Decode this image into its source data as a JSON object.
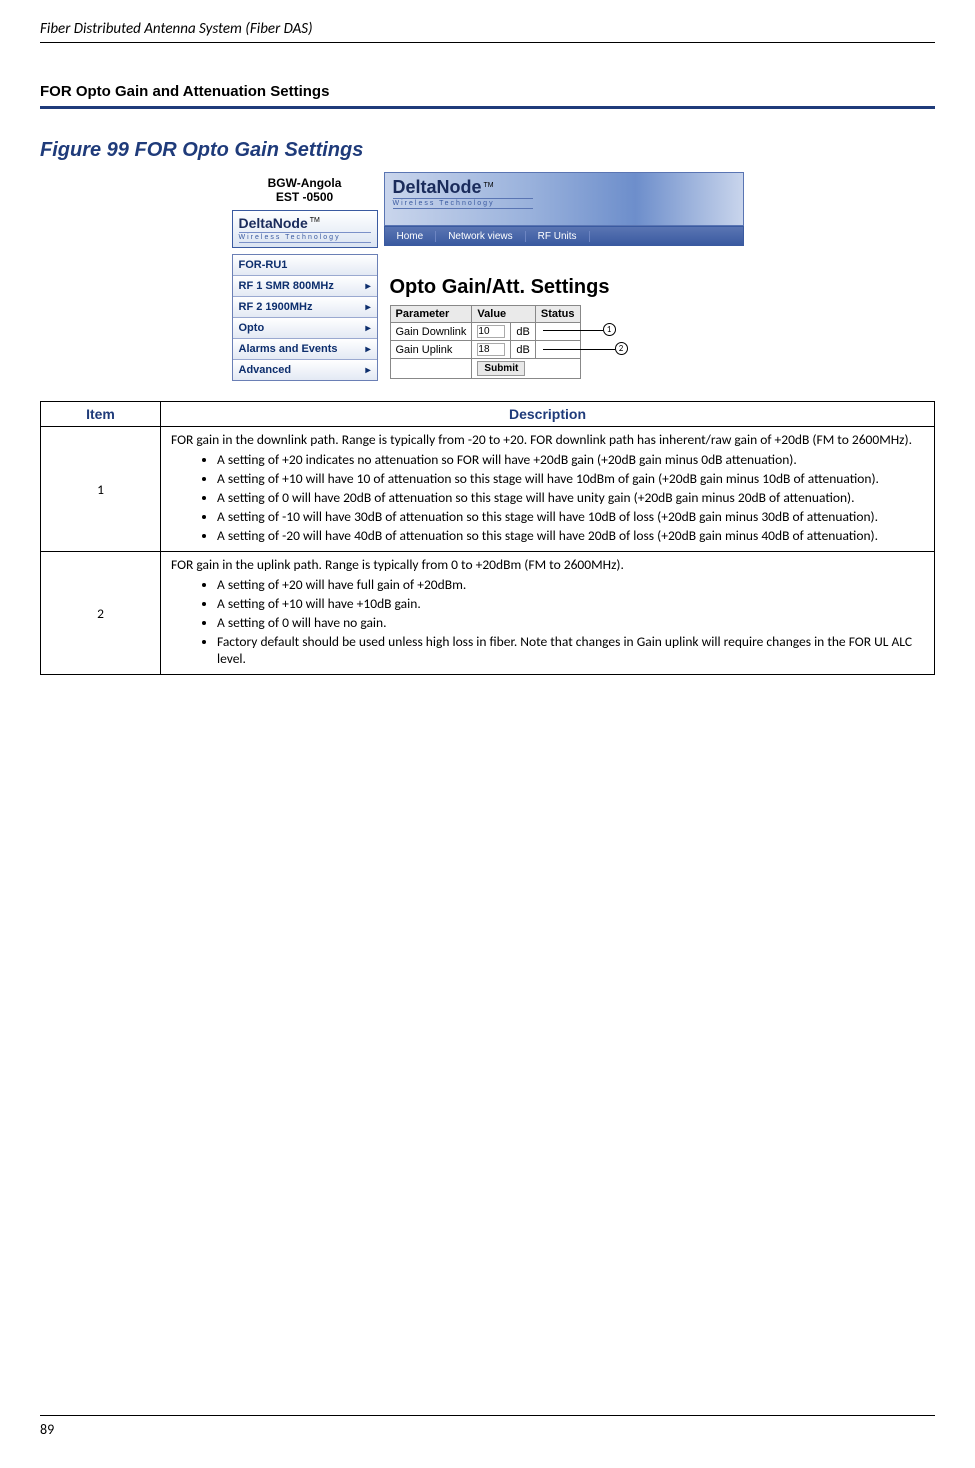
{
  "header": "Fiber Distributed Antenna System (Fiber DAS)",
  "section_title": "FOR Opto Gain and Attenuation Settings",
  "figure_title": "Figure 99    FOR Opto Gain Settings",
  "bgw": {
    "line1": "BGW-Angola",
    "line2": "EST -0500"
  },
  "brand": "DeltaNode",
  "brand_sub": "Wireless   Technology",
  "tm": "TM",
  "side_menu": {
    "items": [
      "FOR-RU1",
      "RF 1 SMR 800MHz",
      "RF 2 1900MHz",
      "Opto",
      "Alarms and Events",
      "Advanced"
    ]
  },
  "nav_tabs": [
    "Home",
    "Network views",
    "RF Units"
  ],
  "settings_title": "Opto Gain/Att. Settings",
  "param_table": {
    "headers": [
      "Parameter",
      "Value",
      "Status"
    ],
    "rows": [
      {
        "param": "Gain Downlink",
        "value": "10",
        "unit": "dB"
      },
      {
        "param": "Gain Uplink",
        "value": "18",
        "unit": "dB"
      }
    ],
    "submit": "Submit"
  },
  "callouts": {
    "one": "1",
    "two": "2"
  },
  "desc_table": {
    "headers": {
      "item": "Item",
      "desc": "Description"
    },
    "rows": [
      {
        "num": "1",
        "intro": "FOR gain in the downlink path.  Range is typically from -20 to +20. FOR downlink path has inherent/raw gain of +20dB (FM to 2600MHz).",
        "bullets": [
          "A setting of +20 indicates no attenuation so FOR will have +20dB gain (+20dB gain minus 0dB attenuation).",
          "A setting of +10 will have 10 of attenuation so this stage will have 10dBm of gain (+20dB gain minus 10dB of attenuation).",
          "A setting of 0 will have 20dB of attenuation so this stage will have unity gain (+20dB gain minus 20dB of attenuation).",
          "A setting of -10 will have 30dB of attenuation so this stage will have 10dB of loss (+20dB gain minus 30dB of attenuation).",
          "A setting of -20 will have 40dB of attenuation so this stage will have 20dB of loss (+20dB gain minus 40dB of attenuation)."
        ]
      },
      {
        "num": "2",
        "intro": "FOR gain in the uplink path. Range is typically from 0 to +20dBm (FM to 2600MHz).",
        "bullets": [
          "A setting of +20 will have full gain of +20dBm.",
          "A setting of +10 will have +10dB gain.",
          "A setting of 0 will have no gain.",
          "Factory default should be used unless high loss in fiber.  Note that changes in Gain uplink will require changes in the FOR UL ALC level."
        ]
      }
    ]
  },
  "page_num": "89"
}
